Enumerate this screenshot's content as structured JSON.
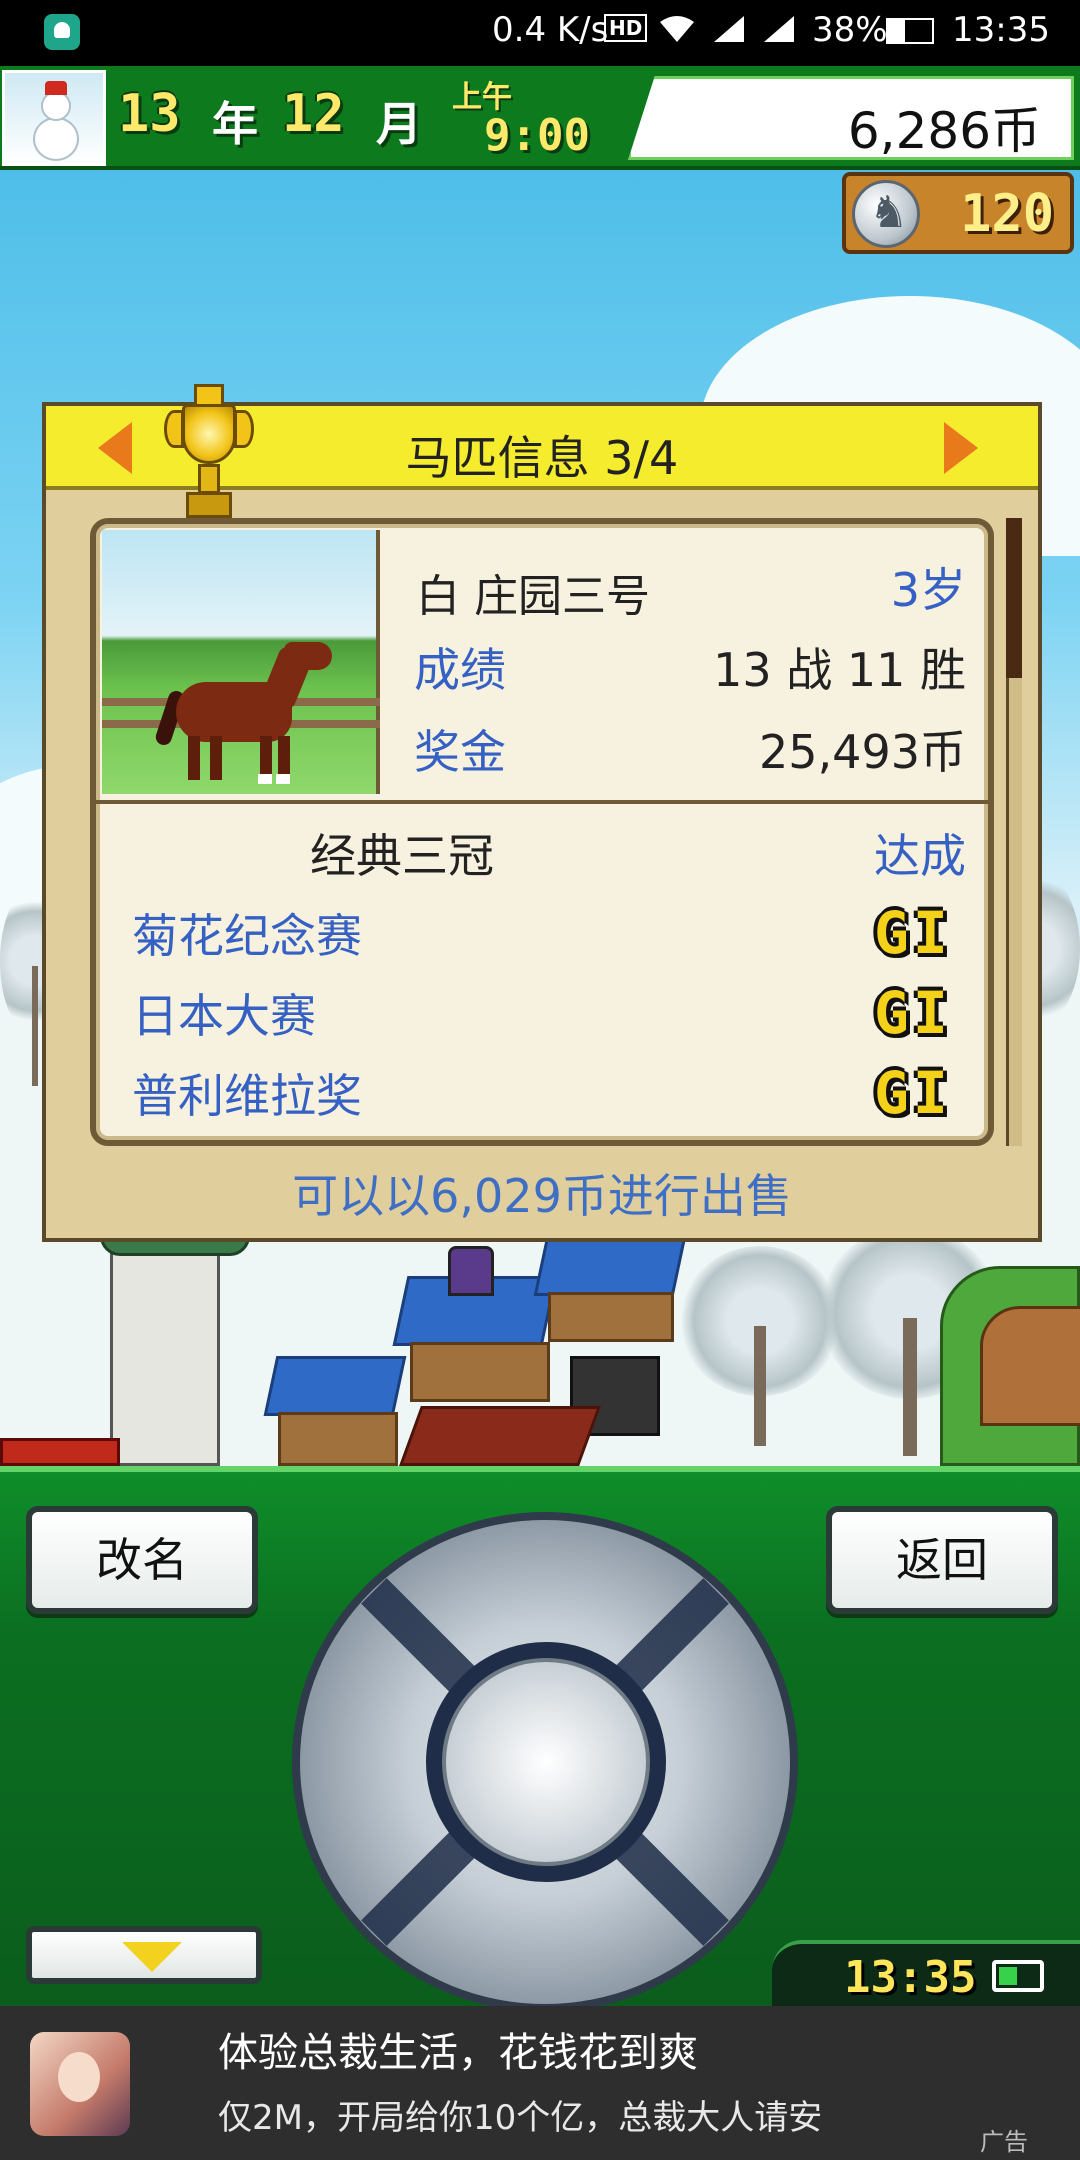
{
  "status_bar": {
    "net_speed": "0.4 K/s",
    "hd_label": "HD",
    "battery_pct": "38%",
    "time": "13:35"
  },
  "hud": {
    "year": "13",
    "year_unit": "年",
    "month": "12",
    "month_unit": "月",
    "ampm": "上午",
    "time": "9:00",
    "money": "6,286币",
    "medals": "120"
  },
  "panel": {
    "title": "马匹信息 3/4",
    "horse_name": "白 庄园三号",
    "age": "3岁",
    "record_label": "成绩",
    "record_value": "13 战 11 胜",
    "prize_label": "奖金",
    "prize_value": "25,493币",
    "triple_crown_label": "经典三冠",
    "triple_crown_status": "达成",
    "races": [
      {
        "name": "菊花纪念赛",
        "grade": "GI"
      },
      {
        "name": "日本大赛",
        "grade": "GI"
      },
      {
        "name": "普利维拉奖",
        "grade": "GI"
      }
    ],
    "sale_text": "可以以6,029币进行出售"
  },
  "controls": {
    "rename_label": "改名",
    "back_label": "返回",
    "clock": "13:35"
  },
  "ad": {
    "title": "体验总裁生活，花钱花到爽",
    "subtitle": "仅2M，开局给你10个亿，总裁大人请安",
    "tag": "广告"
  }
}
